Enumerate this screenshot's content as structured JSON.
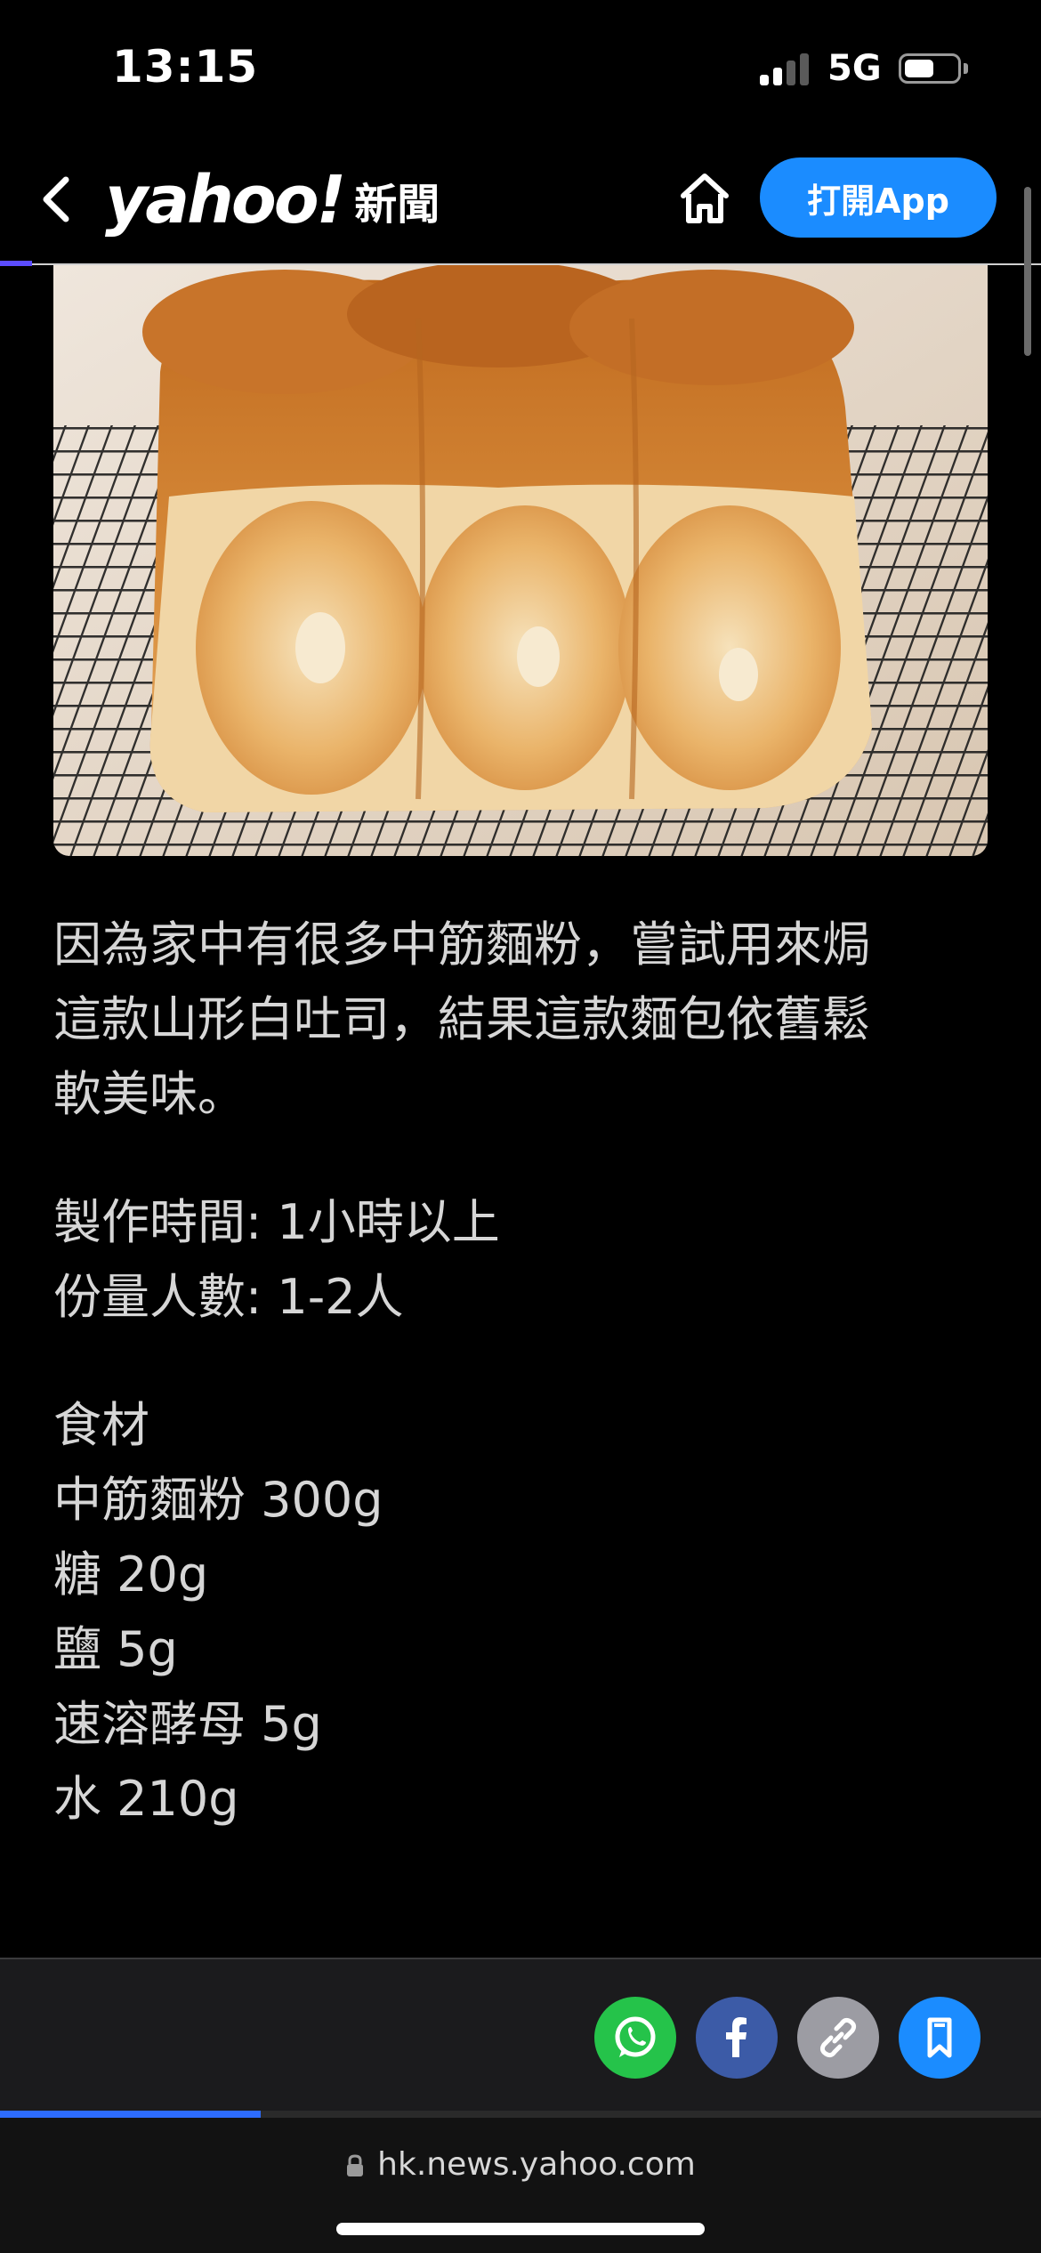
{
  "status_bar": {
    "time": "13:15",
    "network": "5G",
    "signal_bars": 2,
    "battery_level": 0.55
  },
  "header": {
    "logo": "yahoo!",
    "section": "新聞",
    "open_app_label": "打開App"
  },
  "hero_image": {
    "description_icon": "bread-photo"
  },
  "article": {
    "intro_lines": [
      "因為家中有很多中筋麵粉，嘗試用來焗",
      "這款山形白吐司，結果這款麵包依舊鬆",
      "軟美味。"
    ],
    "meta_lines": [
      "製作時間: 1小時以上",
      "份量人數: 1-2人"
    ],
    "ingredients_title": "食材",
    "ingredients": [
      "中筋麵粉 300g",
      "糖 20g",
      "鹽 5g",
      "速溶酵母 5g",
      "水 210g"
    ]
  },
  "share_bar": {
    "buttons": [
      "whatsapp-icon",
      "facebook-icon",
      "link-icon",
      "bookmark-icon"
    ],
    "colors": {
      "whatsapp": "#25c34a",
      "facebook": "#3c5ba7",
      "link": "#9c9ca3",
      "bookmark": "#1b8cff"
    },
    "reading_progress": 0.25
  },
  "url_bar": {
    "url": "hk.news.yahoo.com"
  },
  "colors": {
    "accent": "#1b8cff",
    "background": "#000000"
  }
}
